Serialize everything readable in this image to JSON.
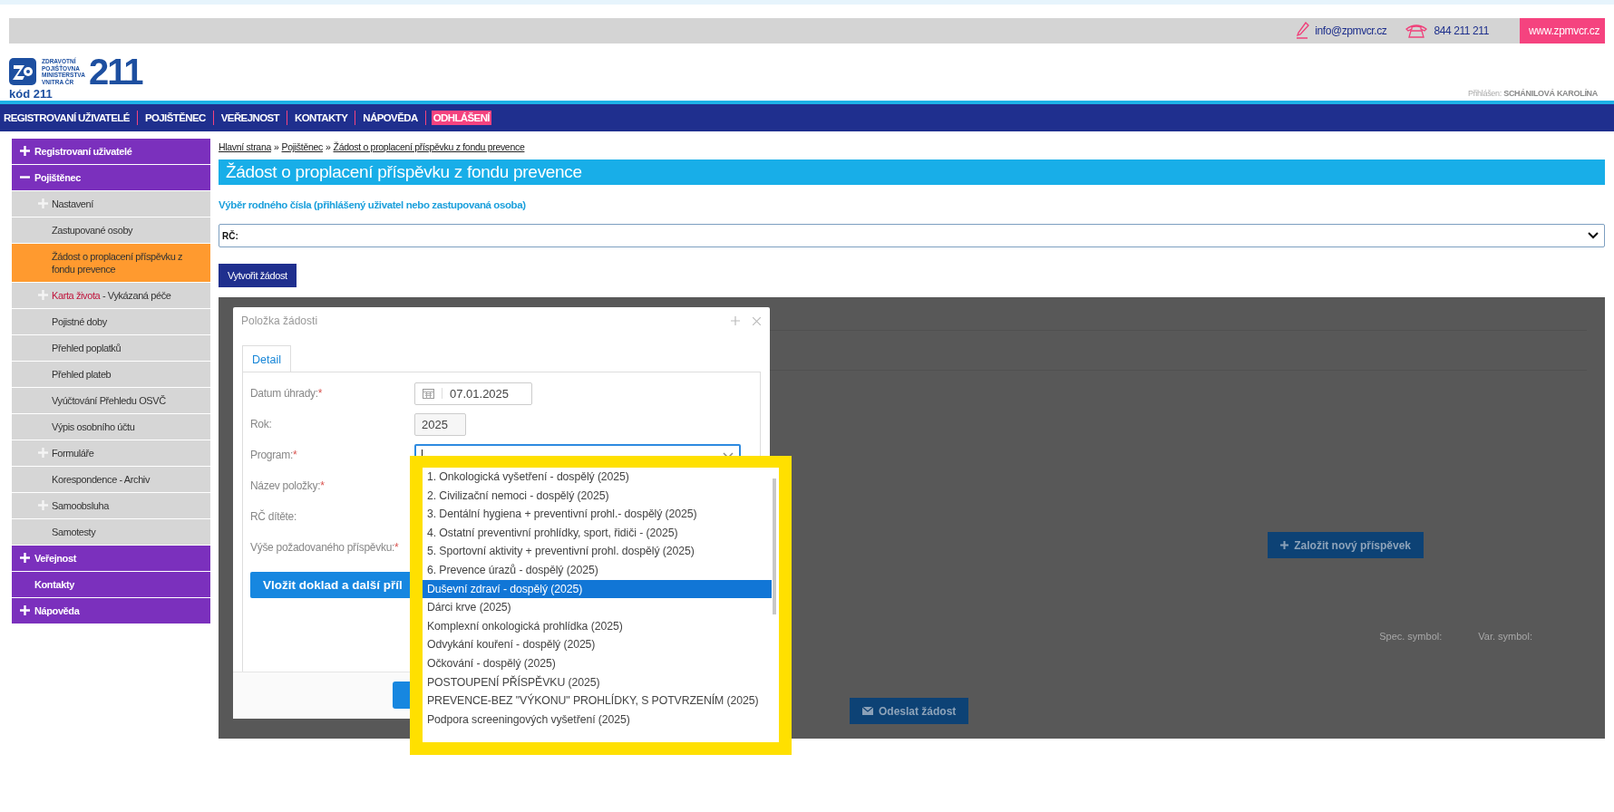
{
  "top_bar": {
    "email": "info@zpmvcr.cz",
    "phone": "844 211 211",
    "website": "www.zpmvcr.cz"
  },
  "logo": {
    "name_lines": [
      "ZDRAVOTNÍ",
      "POJIŠŤOVNA",
      "MINISTERSTVA",
      "VNITRA ČR"
    ],
    "number": "211",
    "code": "kód 211"
  },
  "user": {
    "label": "Přihlášen:",
    "name": "SCHÁNILOVÁ KAROLÍNA"
  },
  "nav": [
    {
      "label": "REGISTROVANÍ UŽIVATELÉ",
      "highlighted": false
    },
    {
      "label": "POJIŠTĚNEC",
      "highlighted": false
    },
    {
      "label": "VEŘEJNOST",
      "highlighted": false
    },
    {
      "label": "KONTAKTY",
      "highlighted": false
    },
    {
      "label": "NÁPOVĚDA",
      "highlighted": false
    },
    {
      "label": "ODHLÁŠENÍ",
      "highlighted": true
    }
  ],
  "sidebar": [
    {
      "kind": "section",
      "label": "Registrovaní uživatelé",
      "expanded": false,
      "selected": false
    },
    {
      "kind": "section",
      "label": "Pojištěnec",
      "expanded": true,
      "selected": false
    },
    {
      "kind": "item",
      "label": "Nastavení",
      "expanded": false,
      "selected": false
    },
    {
      "kind": "item",
      "label": "Zastupované osoby",
      "selected": false
    },
    {
      "kind": "item",
      "label": "Žádost o proplacení příspěvku z fondu prevence",
      "selected": true
    },
    {
      "kind": "item",
      "accent": "Karta života",
      "label": " - Vykázaná péče",
      "expanded": false,
      "selected": false
    },
    {
      "kind": "item",
      "label": "Pojistné doby",
      "selected": false
    },
    {
      "kind": "item",
      "label": "Přehled poplatků",
      "selected": false
    },
    {
      "kind": "item",
      "label": "Přehled plateb",
      "selected": false
    },
    {
      "kind": "item",
      "label": "Vyúčtování Přehledu OSVČ",
      "selected": false
    },
    {
      "kind": "item",
      "label": "Výpis osobního účtu",
      "selected": false
    },
    {
      "kind": "item",
      "label": "Formuláře",
      "expanded": false,
      "selected": false
    },
    {
      "kind": "item",
      "label": "Korespondence - Archiv",
      "selected": false
    },
    {
      "kind": "item",
      "label": "Samoobsluha",
      "expanded": false,
      "selected": false
    },
    {
      "kind": "item",
      "label": "Samotesty",
      "selected": false
    },
    {
      "kind": "section",
      "label": "Veřejnost",
      "expanded": false,
      "selected": false
    },
    {
      "kind": "section",
      "label": "Kontakty",
      "selected": false
    },
    {
      "kind": "section",
      "label": "Nápověda",
      "expanded": false,
      "selected": false
    }
  ],
  "breadcrumb": [
    "Hlavní strana",
    "Pojištěnec",
    "Žádost o proplacení příspěvku z fondu prevence"
  ],
  "breadcrumb_separator": "»",
  "page_title": "Žádost o proplacení příspěvku z fondu prevence",
  "subtitle": "Výběr rodného čísla (přihlášený uživatel nebo zastupovaná osoba)",
  "rc_select": {
    "value": "RČ:"
  },
  "create_button": "Vytvořit žádost",
  "background": {
    "add_button": "Založit nový příspěvek",
    "spec_symbol": "Spec. symbol:",
    "var_symbol": "Var. symbol:",
    "send_button": "Odeslat žádost"
  },
  "modal": {
    "title": "Položka žádosti",
    "tabs": [
      {
        "label": "Detail",
        "selected": true
      }
    ],
    "fields": [
      {
        "kind": "date",
        "label": "Datum úhrady:",
        "required_mark": "*",
        "value": "07.01.2025"
      },
      {
        "kind": "text",
        "label": "Rok:",
        "value": "2025"
      },
      {
        "kind": "combo",
        "label": "Program:",
        "required_mark": "*"
      },
      {
        "kind": "none",
        "label": "Název položky:",
        "required_mark": "*"
      },
      {
        "kind": "none",
        "label": "RČ dítěte:"
      },
      {
        "kind": "none",
        "label": "Výše požadovaného příspěvku:",
        "required_mark": "*"
      }
    ],
    "attach_button": "Vložit doklad a další příl"
  },
  "dropdown": [
    {
      "label": "1. Onkologická vyšetření - dospělý (2025)",
      "selected": false
    },
    {
      "label": "2. Civilizační nemoci - dospělý (2025)",
      "selected": false
    },
    {
      "label": "3. Dentální hygiena + preventivní prohl.- dospělý (2025)",
      "selected": false
    },
    {
      "label": "4. Ostatní preventivní prohlídky, sport, řidiči - (2025)",
      "selected": false
    },
    {
      "label": "5. Sportovní aktivity + preventivní prohl. dospělý (2025)",
      "selected": false
    },
    {
      "label": "6. Prevence úrazů - dospělý (2025)",
      "selected": false
    },
    {
      "label": "Duševní zdraví - dospělý (2025)",
      "selected": true
    },
    {
      "label": "Dárci krve (2025)",
      "selected": false
    },
    {
      "label": "Komplexní onkologická prohlídka (2025)",
      "selected": false
    },
    {
      "label": "Odvykání kouření - dospělý (2025)",
      "selected": false
    },
    {
      "label": "Očkování - dospělý (2025)",
      "selected": false
    },
    {
      "label": "POSTOUPENÍ PŘÍSPĚVKU (2025)",
      "selected": false
    },
    {
      "label": "PREVENCE-BEZ \"VÝKONU\" PROHLÍDKY, S POTVRZENÍM (2025)",
      "selected": false
    },
    {
      "label": "Podpora screeningových vyšetření (2025)",
      "selected": false
    }
  ]
}
